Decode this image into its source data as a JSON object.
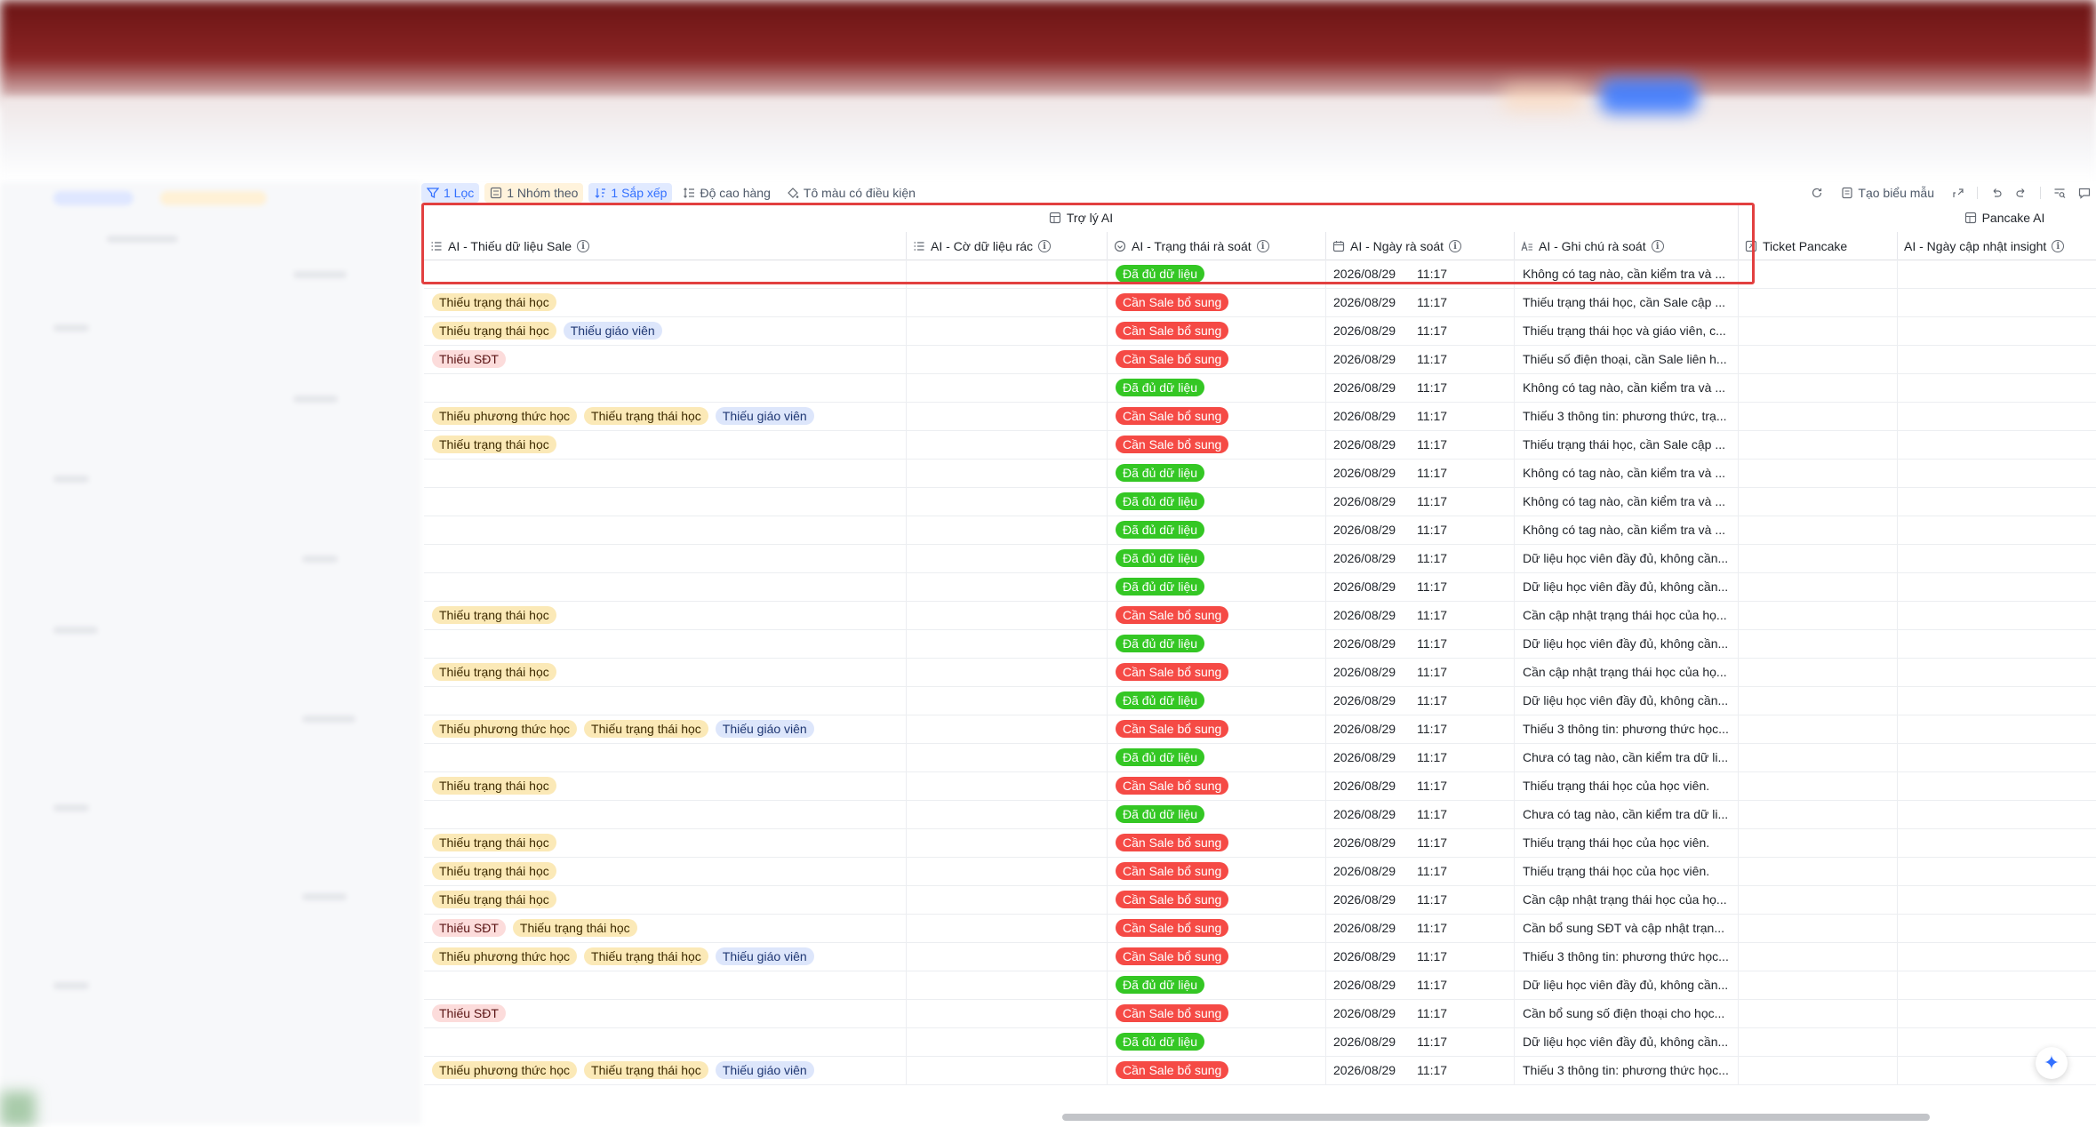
{
  "toolbar": {
    "filter": "1 Lọc",
    "group": "1 Nhóm theo",
    "sort": "1 Sắp xếp",
    "row_height": "Độ cao hàng",
    "conditional_color": "Tô màu có điều kiện",
    "create_form": "Tạo biểu mẫu"
  },
  "groups": {
    "ai_assistant": "Trợ lý AI",
    "pancake_ai": "Pancake AI"
  },
  "columns": {
    "missing": "AI - Thiếu dữ liệu Sale",
    "junk": "AI - Cờ dữ liệu rác",
    "status": "AI - Trạng thái rà soát",
    "date": "AI - Ngày rà soát",
    "note": "AI - Ghi chú rà soát",
    "ticket": "Ticket Pancake",
    "insight_date": "AI - Ngày cập nhật insight"
  },
  "rows": [
    {
      "tags": [],
      "status": "Đã đủ dữ liệu",
      "date": "2026/08/29",
      "time": "11:17",
      "note": "Không có tag nào, cần kiểm tra và ..."
    },
    {
      "tags": [
        "Thiếu trạng thái học"
      ],
      "status": "Cần Sale bổ sung",
      "date": "2026/08/29",
      "time": "11:17",
      "note": "Thiếu trạng thái học, cần Sale cập ..."
    },
    {
      "tags": [
        "Thiếu trạng thái học",
        "Thiếu giáo viên"
      ],
      "status": "Cần Sale bổ sung",
      "date": "2026/08/29",
      "time": "11:17",
      "note": "Thiếu trạng thái học và giáo viên, c..."
    },
    {
      "tags": [
        "Thiếu SĐT"
      ],
      "status": "Cần Sale bổ sung",
      "date": "2026/08/29",
      "time": "11:17",
      "note": "Thiếu số điện thoại, cần Sale liên h..."
    },
    {
      "tags": [],
      "status": "Đã đủ dữ liệu",
      "date": "2026/08/29",
      "time": "11:17",
      "note": "Không có tag nào, cần kiểm tra và ..."
    },
    {
      "tags": [
        "Thiếu phương thức học",
        "Thiếu trạng thái học",
        "Thiếu giáo viên"
      ],
      "status": "Cần Sale bổ sung",
      "date": "2026/08/29",
      "time": "11:17",
      "note": "Thiếu 3 thông tin: phương thức, trạ..."
    },
    {
      "tags": [
        "Thiếu trạng thái học"
      ],
      "status": "Cần Sale bổ sung",
      "date": "2026/08/29",
      "time": "11:17",
      "note": "Thiếu trạng thái học, cần Sale cập ..."
    },
    {
      "tags": [],
      "status": "Đã đủ dữ liệu",
      "date": "2026/08/29",
      "time": "11:17",
      "note": "Không có tag nào, cần kiểm tra và ..."
    },
    {
      "tags": [],
      "status": "Đã đủ dữ liệu",
      "date": "2026/08/29",
      "time": "11:17",
      "note": "Không có tag nào, cần kiểm tra và ..."
    },
    {
      "tags": [],
      "status": "Đã đủ dữ liệu",
      "date": "2026/08/29",
      "time": "11:17",
      "note": "Không có tag nào, cần kiểm tra và ..."
    },
    {
      "tags": [],
      "status": "Đã đủ dữ liệu",
      "date": "2026/08/29",
      "time": "11:17",
      "note": "Dữ liệu học viên đầy đủ, không cần..."
    },
    {
      "tags": [],
      "status": "Đã đủ dữ liệu",
      "date": "2026/08/29",
      "time": "11:17",
      "note": "Dữ liệu học viên đầy đủ, không cần..."
    },
    {
      "tags": [
        "Thiếu trạng thái học"
      ],
      "status": "Cần Sale bổ sung",
      "date": "2026/08/29",
      "time": "11:17",
      "note": "Cần cập nhật trạng thái học của họ..."
    },
    {
      "tags": [],
      "status": "Đã đủ dữ liệu",
      "date": "2026/08/29",
      "time": "11:17",
      "note": "Dữ liệu học viên đầy đủ, không cần..."
    },
    {
      "tags": [
        "Thiếu trạng thái học"
      ],
      "status": "Cần Sale bổ sung",
      "date": "2026/08/29",
      "time": "11:17",
      "note": "Cần cập nhật trạng thái học của họ..."
    },
    {
      "tags": [],
      "status": "Đã đủ dữ liệu",
      "date": "2026/08/29",
      "time": "11:17",
      "note": "Dữ liệu học viên đầy đủ, không cần..."
    },
    {
      "tags": [
        "Thiếu phương thức học",
        "Thiếu trạng thái học",
        "Thiếu giáo viên"
      ],
      "status": "Cần Sale bổ sung",
      "date": "2026/08/29",
      "time": "11:17",
      "note": "Thiếu 3 thông tin: phương thức học..."
    },
    {
      "tags": [],
      "status": "Đã đủ dữ liệu",
      "date": "2026/08/29",
      "time": "11:17",
      "note": "Chưa có tag nào, cần kiểm tra dữ li..."
    },
    {
      "tags": [
        "Thiếu trạng thái học"
      ],
      "status": "Cần Sale bổ sung",
      "date": "2026/08/29",
      "time": "11:17",
      "note": "Thiếu trạng thái học của học viên."
    },
    {
      "tags": [],
      "status": "Đã đủ dữ liệu",
      "date": "2026/08/29",
      "time": "11:17",
      "note": "Chưa có tag nào, cần kiểm tra dữ li..."
    },
    {
      "tags": [
        "Thiếu trạng thái học"
      ],
      "status": "Cần Sale bổ sung",
      "date": "2026/08/29",
      "time": "11:17",
      "note": "Thiếu trạng thái học của học viên."
    },
    {
      "tags": [
        "Thiếu trạng thái học"
      ],
      "status": "Cần Sale bổ sung",
      "date": "2026/08/29",
      "time": "11:17",
      "note": "Thiếu trạng thái học của học viên."
    },
    {
      "tags": [
        "Thiếu trạng thái học"
      ],
      "status": "Cần Sale bổ sung",
      "date": "2026/08/29",
      "time": "11:17",
      "note": "Cần cập nhật trạng thái học của họ..."
    },
    {
      "tags": [
        "Thiếu SĐT",
        "Thiếu trạng thái học"
      ],
      "status": "Cần Sale bổ sung",
      "date": "2026/08/29",
      "time": "11:17",
      "note": "Cần bổ sung SĐT và cập nhật trạn..."
    },
    {
      "tags": [
        "Thiếu phương thức học",
        "Thiếu trạng thái học",
        "Thiếu giáo viên"
      ],
      "status": "Cần Sale bổ sung",
      "date": "2026/08/29",
      "time": "11:17",
      "note": "Thiếu 3 thông tin: phương thức học..."
    },
    {
      "tags": [],
      "status": "Đã đủ dữ liệu",
      "date": "2026/08/29",
      "time": "11:17",
      "note": "Dữ liệu học viên đầy đủ, không cần..."
    },
    {
      "tags": [
        "Thiếu SĐT"
      ],
      "status": "Cần Sale bổ sung",
      "date": "2026/08/29",
      "time": "11:17",
      "note": "Cần bổ sung số điện thoại cho học..."
    },
    {
      "tags": [],
      "status": "Đã đủ dữ liệu",
      "date": "2026/08/29",
      "time": "11:17",
      "note": "Dữ liệu học viên đầy đủ, không cần..."
    },
    {
      "tags": [
        "Thiếu phương thức học",
        "Thiếu trạng thái học",
        "Thiếu giáo viên"
      ],
      "status": "Cần Sale bổ sung",
      "date": "2026/08/29",
      "time": "11:17",
      "note": "Thiếu 3 thông tin: phương thức học..."
    }
  ],
  "tag_colors": {
    "Thiếu trạng thái học": "yellow",
    "Thiếu phương thức học": "yellow",
    "Thiếu giáo viên": "blue",
    "Thiếu SĐT": "pink"
  },
  "status_colors": {
    "Đã đủ dữ liệu": "#34c724",
    "Cần Sale bổ sung": "#f54a45"
  },
  "accent": "#3370ff",
  "highlight_color": "#e24040"
}
